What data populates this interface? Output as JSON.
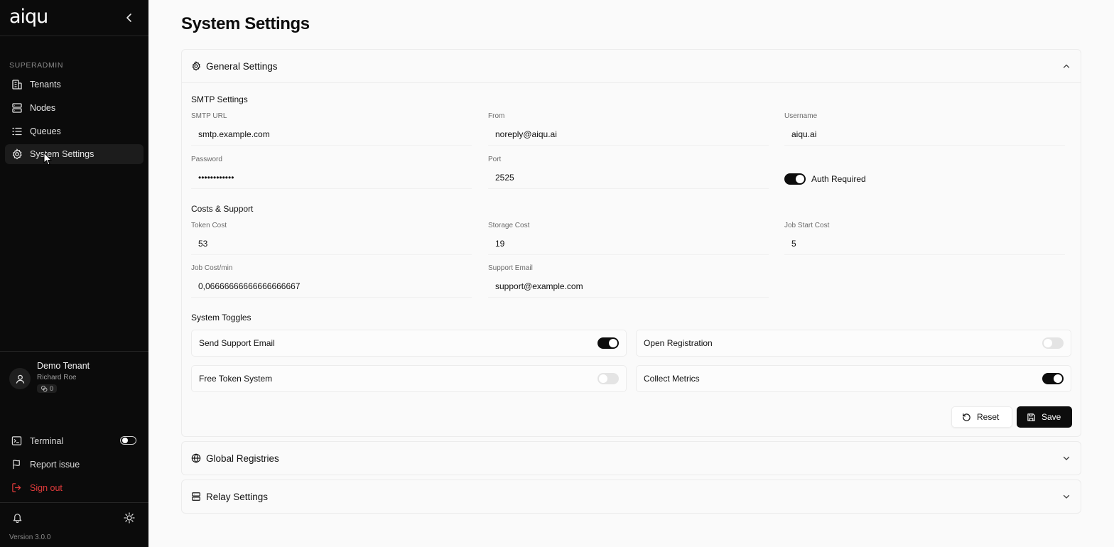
{
  "sidebar": {
    "logo": "aiqu",
    "section_label": "SUPERADMIN",
    "nav": [
      {
        "label": "Tenants",
        "icon": "building-icon"
      },
      {
        "label": "Nodes",
        "icon": "server-icon"
      },
      {
        "label": "Queues",
        "icon": "list-icon"
      },
      {
        "label": "System Settings",
        "icon": "gear-icon",
        "active": true
      }
    ],
    "user": {
      "tenant": "Demo Tenant",
      "name": "Richard Roe",
      "badge_count": "0"
    },
    "terminal_label": "Terminal",
    "terminal_enabled": false,
    "report_label": "Report issue",
    "signout_label": "Sign out",
    "version": "Version 3.0.0"
  },
  "page": {
    "title": "System Settings"
  },
  "general": {
    "title": "General Settings",
    "expanded": true,
    "smtp": {
      "title": "SMTP Settings",
      "url_label": "SMTP URL",
      "url": "smtp.example.com",
      "from_label": "From",
      "from": "noreply@aiqu.ai",
      "username_label": "Username",
      "username": "aiqu.ai",
      "password_label": "Password",
      "password": "••••••••••••",
      "port_label": "Port",
      "port": "2525",
      "auth_label": "Auth Required",
      "auth_required": true
    },
    "costs": {
      "title": "Costs & Support",
      "token_label": "Token Cost",
      "token": "53",
      "storage_label": "Storage Cost",
      "storage": "19",
      "jobstart_label": "Job Start Cost",
      "jobstart": "5",
      "jobmin_label": "Job Cost/min",
      "jobmin": "0,06666666666666666667",
      "email_label": "Support Email",
      "email": "support@example.com"
    },
    "toggles": {
      "title": "System Toggles",
      "items": [
        {
          "label": "Send Support Email",
          "on": true
        },
        {
          "label": "Open Registration",
          "on": false
        },
        {
          "label": "Free Token System",
          "on": false
        },
        {
          "label": "Collect Metrics",
          "on": true
        }
      ]
    },
    "reset_label": "Reset",
    "save_label": "Save"
  },
  "registries": {
    "title": "Global Registries"
  },
  "relay": {
    "title": "Relay Settings"
  },
  "colors": {
    "sidebar_bg": "#0b0b0b",
    "accent": "#0d0d0d",
    "danger": "#e23b3b",
    "page_bg": "#fafafa"
  }
}
